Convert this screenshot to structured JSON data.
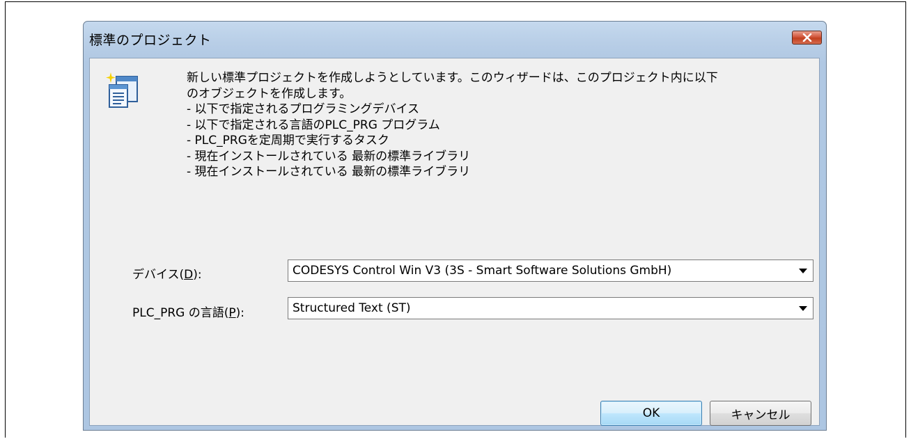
{
  "window": {
    "title": "標準のプロジェクト",
    "close_icon": "close-icon"
  },
  "message": {
    "lines": [
      "新しい標準プロジェクトを作成しようとしています。このウィザードは、このプロジェクト内に以下",
      "のオブジェクトを作成します。",
      "- 以下で指定されるプログラミングデバイス",
      "- 以下で指定される言語のPLC_PRG プログラム",
      "- PLC_PRGを定周期で実行するタスク",
      "- 現在インストールされている 最新の標準ライブラリ",
      "- 現在インストールされている 最新の標準ライブラリ"
    ]
  },
  "device": {
    "label_before": "デバイス(",
    "label_key": "D",
    "label_after": "):",
    "value": "CODESYS Control Win V3 (3S - Smart Software Solutions GmbH)"
  },
  "language": {
    "label_before": "PLC_PRG の言語(",
    "label_key": "P",
    "label_after": "):",
    "value": "Structured Text (ST)"
  },
  "buttons": {
    "ok": "OK",
    "cancel": "キャンセル"
  },
  "colors": {
    "accent_close": "#c2401f",
    "frame": "#b0c8e3",
    "default_button": "#bee6fd"
  }
}
